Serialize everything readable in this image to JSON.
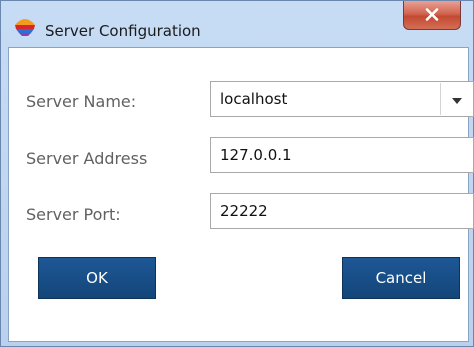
{
  "window": {
    "title": "Server Configuration",
    "close_glyph": "X",
    "app_icon": "app-logo-icon"
  },
  "form": {
    "server_name": {
      "label": "Server Name:",
      "value": "localhost",
      "icon": "chevron-down-icon"
    },
    "server_address": {
      "label": "Server Address",
      "value": "127.0.0.1"
    },
    "server_port": {
      "label": "Server Port:",
      "value": "22222"
    }
  },
  "buttons": {
    "ok": "OK",
    "cancel": "Cancel"
  },
  "colors": {
    "button_bg": "#1a5089",
    "title_bg": "#c0d7f2",
    "close_bg": "#c9503a",
    "label_text": "#616161"
  }
}
